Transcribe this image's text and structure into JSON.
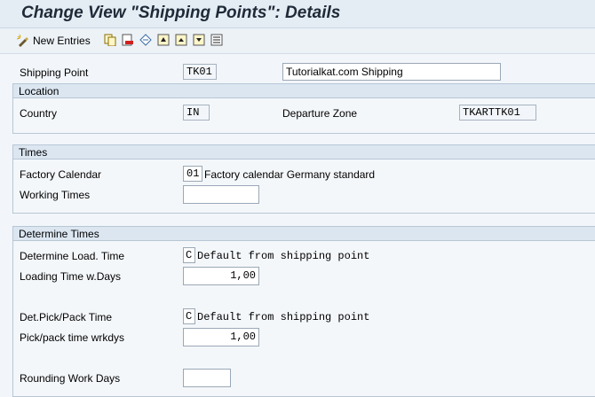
{
  "window": {
    "title": "Change View \"Shipping Points\": Details"
  },
  "toolbar": {
    "new_entries_label": "New Entries",
    "icons": [
      "new-entries-icon",
      "copy-icon",
      "delete-icon",
      "undo-icon",
      "first-entry-icon",
      "previous-entry-icon",
      "next-entry-icon",
      "last-entry-icon"
    ]
  },
  "header": {
    "shipping_point_label": "Shipping Point",
    "shipping_point_value": "TK01",
    "shipping_point_desc": "Tutorialkat.com Shipping"
  },
  "location": {
    "title": "Location",
    "country_label": "Country",
    "country_value": "IN",
    "departure_zone_label": "Departure Zone",
    "departure_zone_value": "TKARTTK01"
  },
  "times": {
    "title": "Times",
    "factory_calendar_label": "Factory Calendar",
    "factory_calendar_value": "01",
    "factory_calendar_desc": "Factory calendar Germany standard",
    "working_times_label": "Working Times",
    "working_times_value": ""
  },
  "determine_times": {
    "title": "Determine Times",
    "load_time_label": "Determine Load. Time",
    "load_time_value": "C",
    "load_time_desc": "Default from shipping point",
    "loading_days_label": "Loading Time w.Days",
    "loading_days_value": "1,00",
    "pick_pack_label": "Det.Pick/Pack Time",
    "pick_pack_value": "C",
    "pick_pack_desc": "Default from shipping point",
    "pick_pack_days_label": "Pick/pack time wrkdys",
    "pick_pack_days_value": "1,00",
    "rounding_label": "Rounding Work Days",
    "rounding_value": ""
  }
}
